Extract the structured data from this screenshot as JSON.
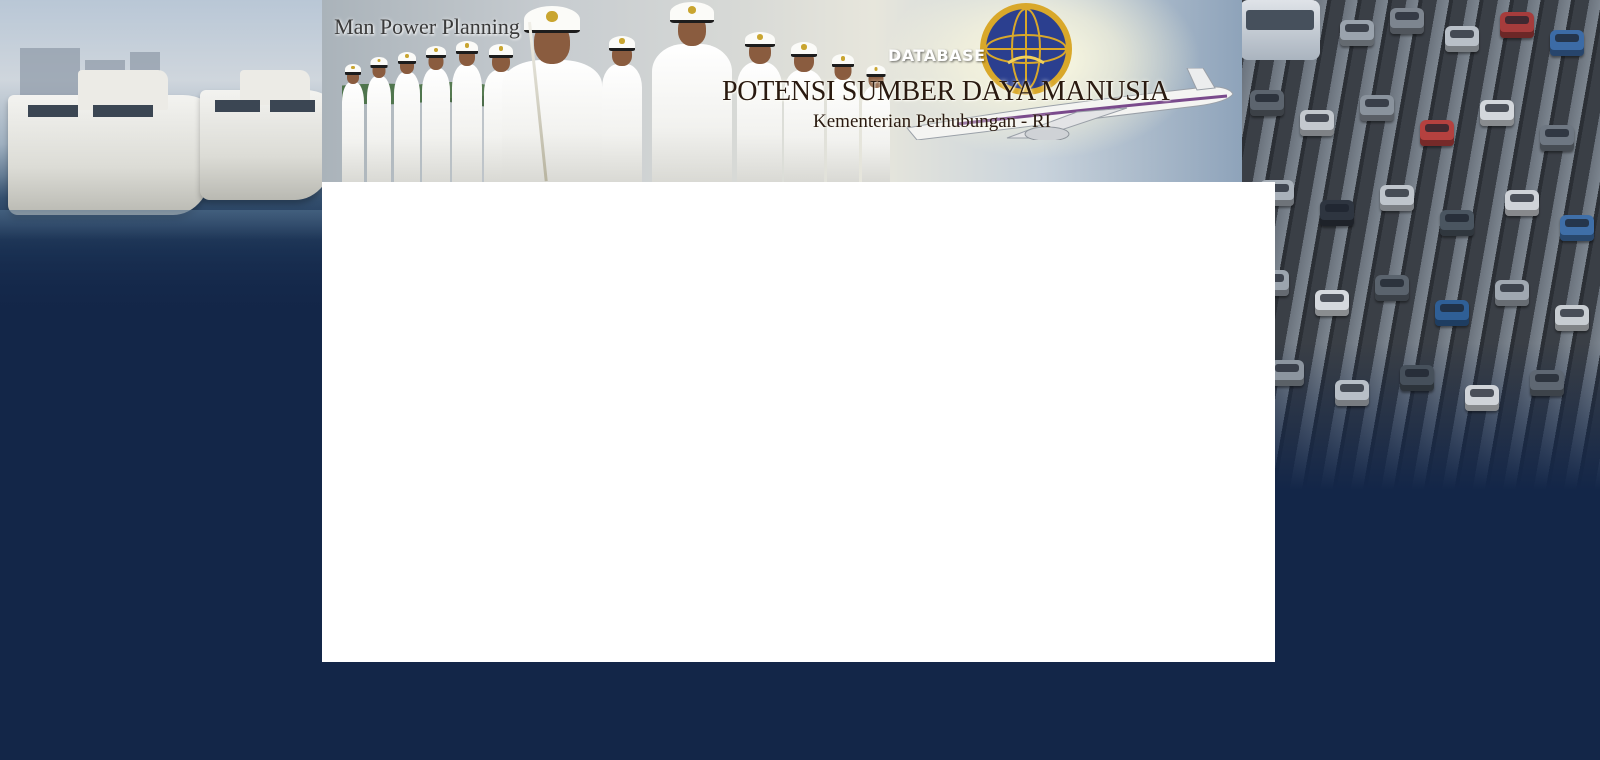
{
  "header": {
    "app_title": "Man Power Planning",
    "database_label": "DATABASE",
    "main_title": "POTENSI SUMBER DAYA MANUSIA",
    "subtitle": "Kementerian Perhubungan - RI"
  },
  "icons": {
    "emblem": "ministry-emblem-icon",
    "plane": "airplane-icon"
  },
  "colors": {
    "background": "#132648",
    "content_panel": "#ffffff",
    "title_text": "#2a1a10",
    "emblem_blue": "#2b3f8f",
    "emblem_gold": "#d9a82a"
  }
}
